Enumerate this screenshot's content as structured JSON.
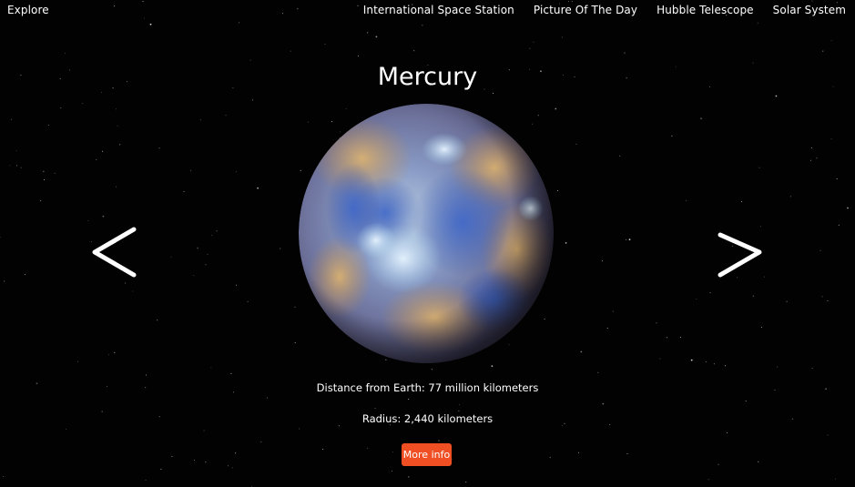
{
  "navbar": {
    "brand": "Explore",
    "links": [
      "International Space Station",
      "Picture Of The Day",
      "Hubble Telescope",
      "Solar System"
    ]
  },
  "planet": {
    "name": "Mercury",
    "distance_text": "Distance from Earth: 77 million kilometers",
    "radius_text": "Radius: 2,440 kilometers",
    "more_button": "More info"
  },
  "carousel": {
    "prev_icon": "chevron-left-icon",
    "next_icon": "chevron-right-icon"
  },
  "colors": {
    "background": "#000000",
    "text": "#ffffff",
    "accent_button": "#f04e23"
  }
}
